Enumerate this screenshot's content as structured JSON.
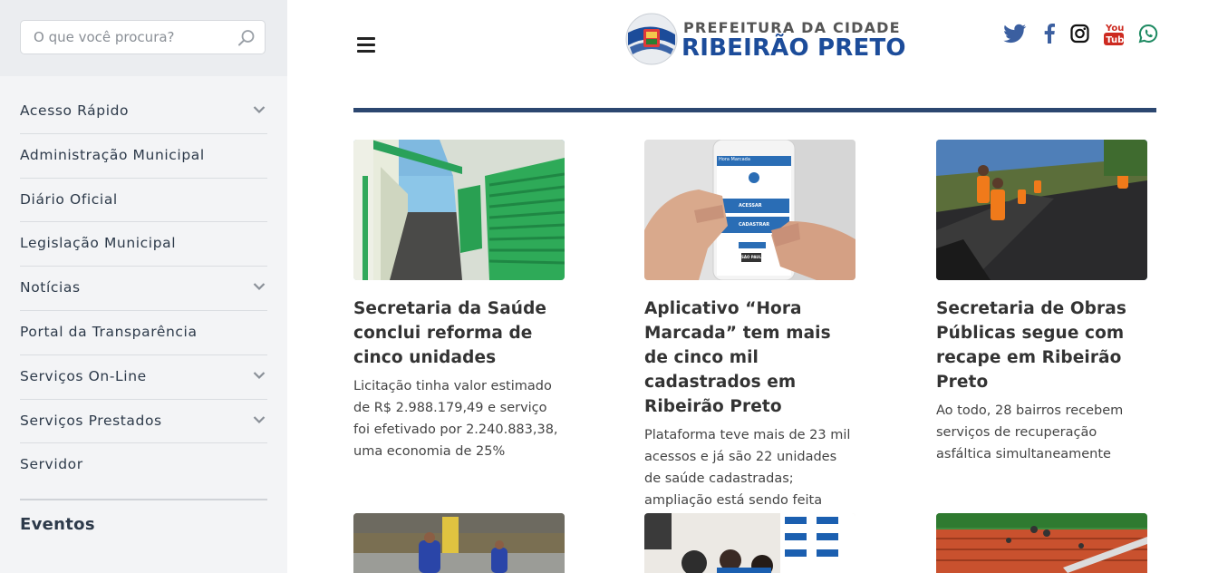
{
  "search": {
    "placeholder": "O que você procura?"
  },
  "sidebar": {
    "items": [
      {
        "label": "Acesso Rápido",
        "has_submenu": true
      },
      {
        "label": "Administração Municipal",
        "has_submenu": false
      },
      {
        "label": "Diário Oficial",
        "has_submenu": false
      },
      {
        "label": "Legislação Municipal",
        "has_submenu": false
      },
      {
        "label": "Notícias",
        "has_submenu": true
      },
      {
        "label": "Portal da Transparência",
        "has_submenu": false
      },
      {
        "label": "Serviços On-Line",
        "has_submenu": true
      },
      {
        "label": "Serviços Prestados",
        "has_submenu": true
      },
      {
        "label": "Servidor",
        "has_submenu": false
      }
    ],
    "events_title": "Eventos"
  },
  "header": {
    "logo_line1": "PREFEITURA DA CIDADE",
    "logo_line2": "RIBEIRÃO PRETO",
    "social_icons": [
      "twitter-icon",
      "facebook-icon",
      "instagram-icon",
      "youtube-icon",
      "whatsapp-icon"
    ]
  },
  "news": [
    {
      "title": "Secretaria da Saúde conclui reforma de cinco unidades",
      "description": "Licitação tinha valor estimado de R$ 2.988.179,49 e serviço foi efetivado por 2.240.883,38, uma economia de 25%"
    },
    {
      "title": "Aplicativo “Hora Marcada” tem mais de cinco mil cadastrados em Ribeirão Preto",
      "description": "Plataforma teve mais de 23 mil acessos e já são 22 unidades de saúde cadastradas; ampliação está sendo feita gradativamente"
    },
    {
      "title": "Secretaria de Obras Públicas segue com recape em Ribeirão Preto",
      "description": "Ao todo, 28 bairros recebem serviços de recuperação asfáltica simultaneamente"
    }
  ],
  "app_mock": {
    "header": "Hora Marcada",
    "btn1": "ACESSAR",
    "btn2": "CADASTRAR",
    "brand": "SÃO PAULO"
  },
  "colors": {
    "brand_blue": "#1c4c9a",
    "header_rule": "#2c4770",
    "sidebar_bg": "#f3f4f6",
    "social_blue": "#3b5fa0",
    "youtube_red": "#cd2a20",
    "whatsapp_green": "#1e8a62"
  }
}
